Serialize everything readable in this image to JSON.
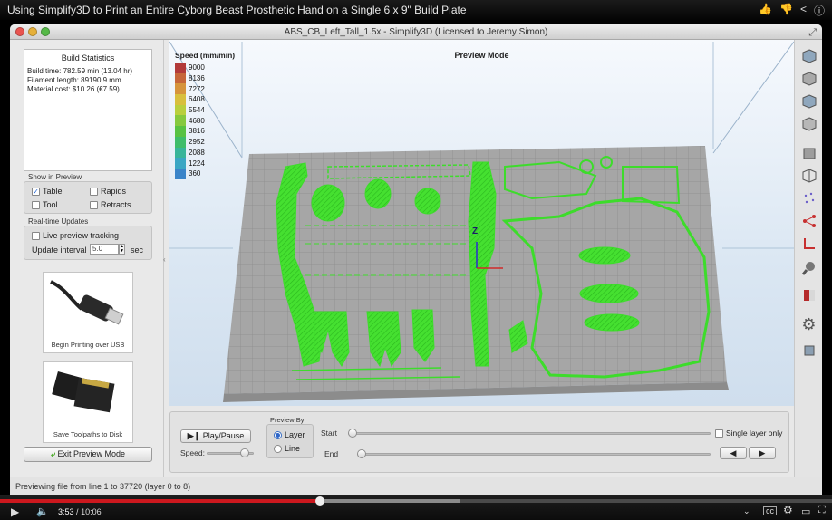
{
  "video": {
    "title": "Using Simplify3D to Print an Entire Cyborg Beast Prosthetic Hand on a Single 6 x 9\" Build Plate",
    "current_time": "3:53",
    "separator": "/",
    "duration": "10:06",
    "progress_fraction": 0.385,
    "buffered_fraction": 0.552
  },
  "window": {
    "title": "ABS_CB_Left_Tall_1.5x - Simplify3D (Licensed to Jeremy Simon)"
  },
  "left_panel": {
    "build_stats_title": "Build Statistics",
    "stats": [
      "Build time: 782.59 min (13.04 hr)",
      "Filament length: 89190.9 mm",
      "Material cost: $10.26 (€7.59)"
    ],
    "show_in_preview_label": "Show in Preview",
    "checkboxes": [
      {
        "label": "Table",
        "checked": true
      },
      {
        "label": "Rapids",
        "checked": false
      },
      {
        "label": "Tool",
        "checked": false
      },
      {
        "label": "Retracts",
        "checked": false
      }
    ],
    "realtime_label": "Real-time Updates",
    "live_tracking_label": "Live preview tracking",
    "update_interval_label": "Update interval",
    "update_interval_value": "5.0",
    "update_interval_unit": "sec",
    "usb_caption": "Begin Printing over USB",
    "sd_caption": "Save Toolpaths to Disk",
    "exit_button": "Exit Preview Mode"
  },
  "viewport": {
    "mode_title": "Preview Mode",
    "speed_title": "Speed (mm/min)",
    "legend": [
      {
        "value": "9000",
        "color": "#b23a3a"
      },
      {
        "value": "8136",
        "color": "#c6663a"
      },
      {
        "value": "7272",
        "color": "#d6943c"
      },
      {
        "value": "6408",
        "color": "#d8bf3e"
      },
      {
        "value": "5544",
        "color": "#b9cf3f"
      },
      {
        "value": "4680",
        "color": "#86c93f"
      },
      {
        "value": "3816",
        "color": "#58c243"
      },
      {
        "value": "2952",
        "color": "#3fbd6a"
      },
      {
        "value": "2088",
        "color": "#38b59a"
      },
      {
        "value": "1224",
        "color": "#3aa6c4"
      },
      {
        "value": "360",
        "color": "#3a84c9"
      }
    ],
    "axis_label": "Z",
    "toolpath_color": "#3ddc2b"
  },
  "controls": {
    "play_pause": "Play/Pause",
    "speed_label": "Speed:",
    "speed_level": 0.8,
    "preview_by_label": "Preview By",
    "preview_by_options": [
      "Layer",
      "Line"
    ],
    "preview_by_selected": "Layer",
    "start_label": "Start",
    "end_label": "End",
    "start_position": 0,
    "end_position": 0,
    "single_layer_label": "Single layer only"
  },
  "status": {
    "text": "Previewing file from line 1 to 37720 (layer 0 to 8)"
  }
}
